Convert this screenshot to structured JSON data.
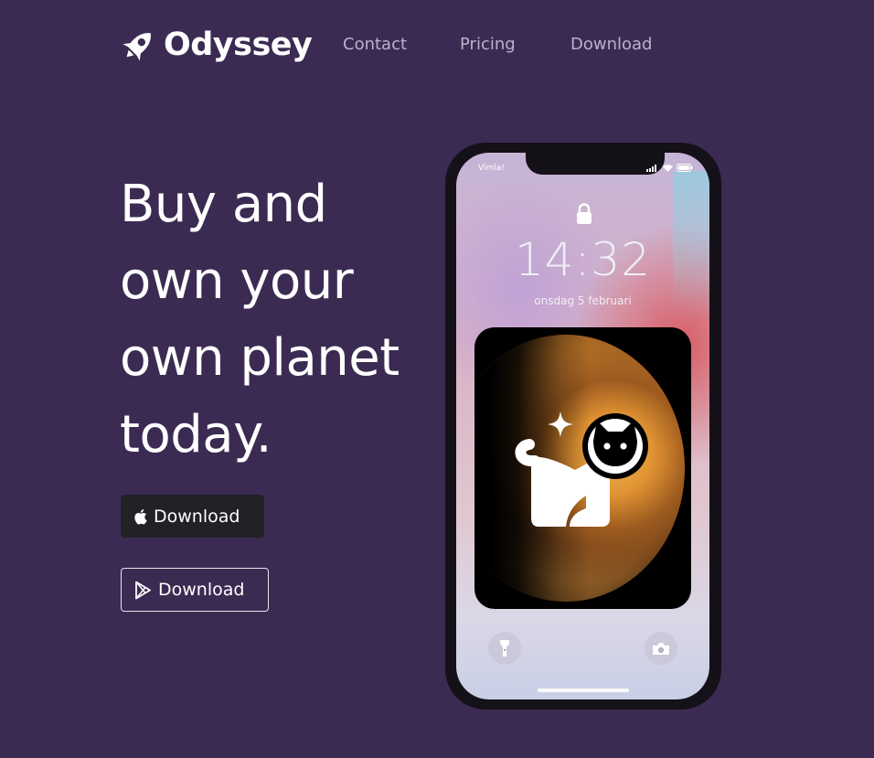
{
  "nav": {
    "brand": "Odyssey",
    "links": [
      "Contact",
      "Pricing",
      "Download"
    ]
  },
  "hero": {
    "headline": "Buy and own your own planet today.",
    "apple_button_label": "Download",
    "play_button_label": "Download"
  },
  "phone": {
    "carrier": "Vimla!",
    "time": "14:32",
    "date": "onsdag 5 februari"
  },
  "icons": {
    "brand": "rocket-logo-icon",
    "apple": "apple-icon",
    "play": "google-play-icon",
    "lock": "lock-icon",
    "torch": "flashlight-icon",
    "camera": "camera-icon",
    "widget": "cat-astronaut-icon"
  },
  "colors": {
    "background": "#3b2b52",
    "apple_button": "#202226",
    "nav_link": "#b9b2c9"
  }
}
